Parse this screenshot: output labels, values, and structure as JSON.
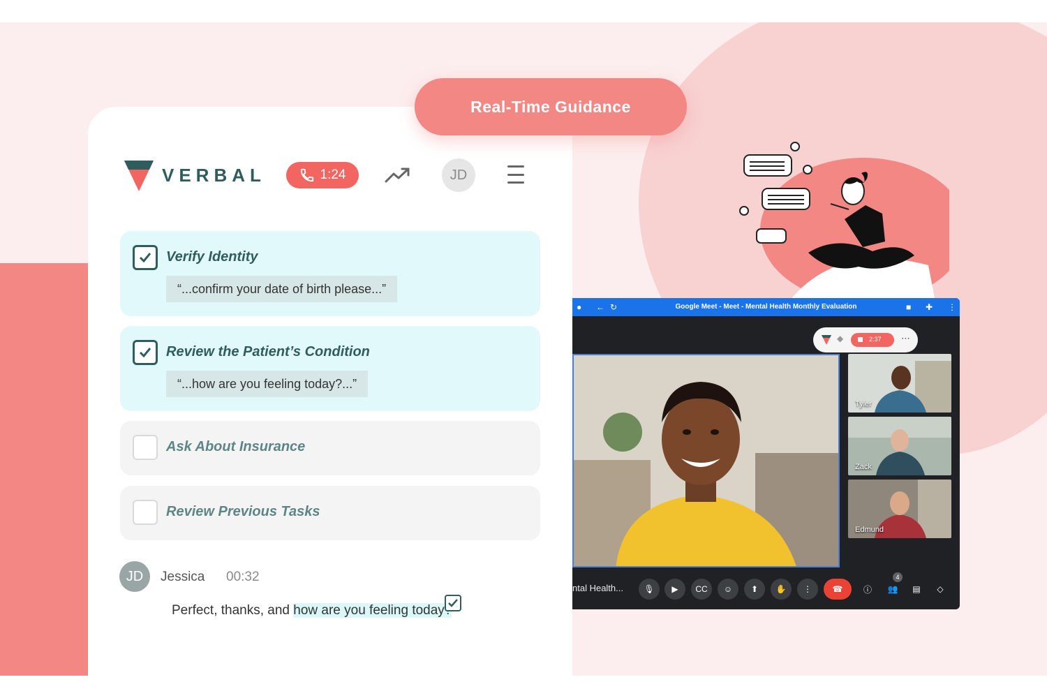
{
  "banner": {
    "label": "Real-Time Guidance"
  },
  "header": {
    "brand": "VERBAL",
    "call_timer": "1:24",
    "user_initials": "JD"
  },
  "checklist": [
    {
      "label": "Verify Identity",
      "quote": "“...confirm your date of birth please...”",
      "checked": true
    },
    {
      "label": "Review the Patient’s Condition",
      "quote": "“...how are you feeling today?...”",
      "checked": true
    },
    {
      "label": "Ask About Insurance",
      "checked": false
    },
    {
      "label": "Review Previous Tasks",
      "checked": false
    }
  ],
  "transcript": {
    "initials": "JD",
    "speaker": "Jessica",
    "time": "00:32",
    "text_before": "Perfect, thanks, and ",
    "text_highlight": "how are you feeling today?"
  },
  "meet": {
    "window_title": "Google Meet - Meet - Mental Health Monthly Evaluation",
    "meeting_name": "ntal Health...",
    "participants": [
      "Tyler",
      "Zack",
      "Edmund"
    ],
    "participant_count": "4",
    "mini_timer": "2:37"
  },
  "colors": {
    "accent": "#f28783",
    "brand_teal": "#2f5d5d",
    "done_bg": "#e1f9fa",
    "meet_blue": "#1a73e8"
  }
}
